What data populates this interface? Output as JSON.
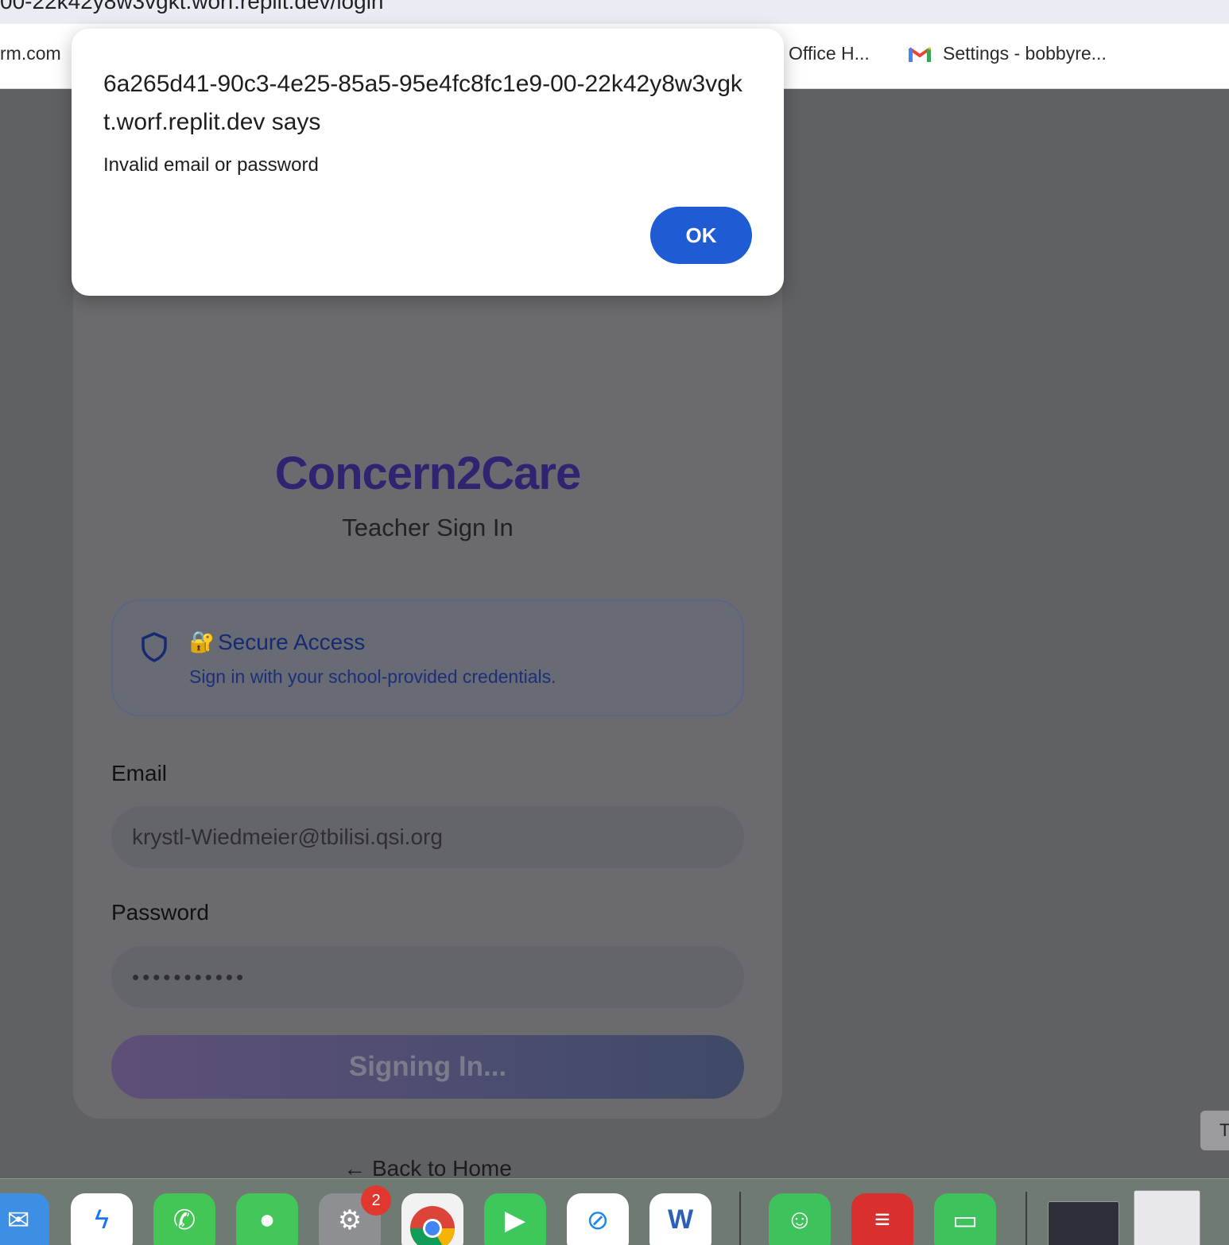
{
  "browser": {
    "url": "00-22k42y8w3vgkt.worf.replit.dev/login",
    "bookmarks": {
      "left": "rm.com",
      "office": "Office H...",
      "gmail": "Settings - bobbyre..."
    }
  },
  "dialog": {
    "title": "6a265d41-90c3-4e25-85a5-95e4fc8fc1e9-00-22k42y8w3vgkt.worf.replit.dev says",
    "message": "Invalid email or password",
    "ok_label": "OK"
  },
  "login": {
    "brand": "Concern2Care",
    "subtitle": "Teacher Sign In",
    "secure": {
      "lock_emoji": "🔐",
      "title": "Secure Access",
      "description": "Sign in with your school-provided credentials."
    },
    "email_label": "Email",
    "email_value": "krystl-Wiedmeier@tbilisi.qsi.org",
    "password_label": "Password",
    "password_value": "•••••••••••",
    "signin_label": "Signing In...",
    "back_link": "← Back to Home"
  },
  "side_tab": "T",
  "dock": {
    "badge_count": "2",
    "icons": [
      "mail-icon",
      "messenger-icon",
      "whatsapp-icon",
      "messages-icon",
      "system-settings-icon",
      "chrome-icon",
      "facetime-icon",
      "safari-icon",
      "word-icon",
      "wechat-icon",
      "expressvpn-icon",
      "chat-icon"
    ]
  },
  "colors": {
    "brand": "#2f2470",
    "ok_button": "#1f5bd3",
    "overlay": "#606164"
  }
}
